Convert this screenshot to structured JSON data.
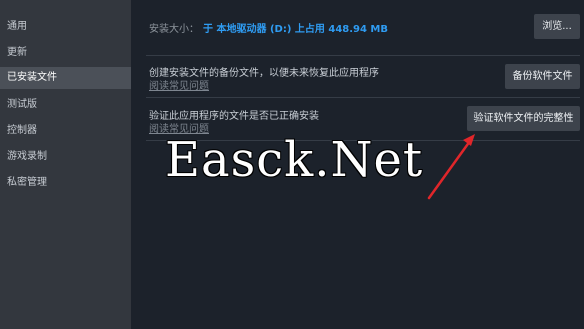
{
  "sidebar": {
    "items": [
      {
        "label": "通用",
        "active": false
      },
      {
        "label": "更新",
        "active": false
      },
      {
        "label": "已安装文件",
        "active": true
      },
      {
        "label": "测试版",
        "active": false
      },
      {
        "label": "控制器",
        "active": false
      },
      {
        "label": "游戏录制",
        "active": false
      },
      {
        "label": "私密管理",
        "active": false
      }
    ]
  },
  "install_size": {
    "label": "安装大小：",
    "value": "于 本地驱动器 (D:) 上占用 448.94 MB",
    "browse_label": "浏览..."
  },
  "backup": {
    "description": "创建安装文件的备份文件，以便未来恢复此应用程序",
    "faq_link": "阅读常见问题",
    "button_label": "备份软件文件"
  },
  "verify": {
    "description": "验证此应用程序的文件是否已正确安装",
    "faq_link": "阅读常见问题",
    "button_label": "验证软件文件的完整性"
  },
  "watermark": "Easck.Net",
  "colors": {
    "accent": "#2f9cf2",
    "arrow": "#e0262a",
    "sidebar_bg": "#33373e",
    "main_bg": "#1c222b"
  }
}
